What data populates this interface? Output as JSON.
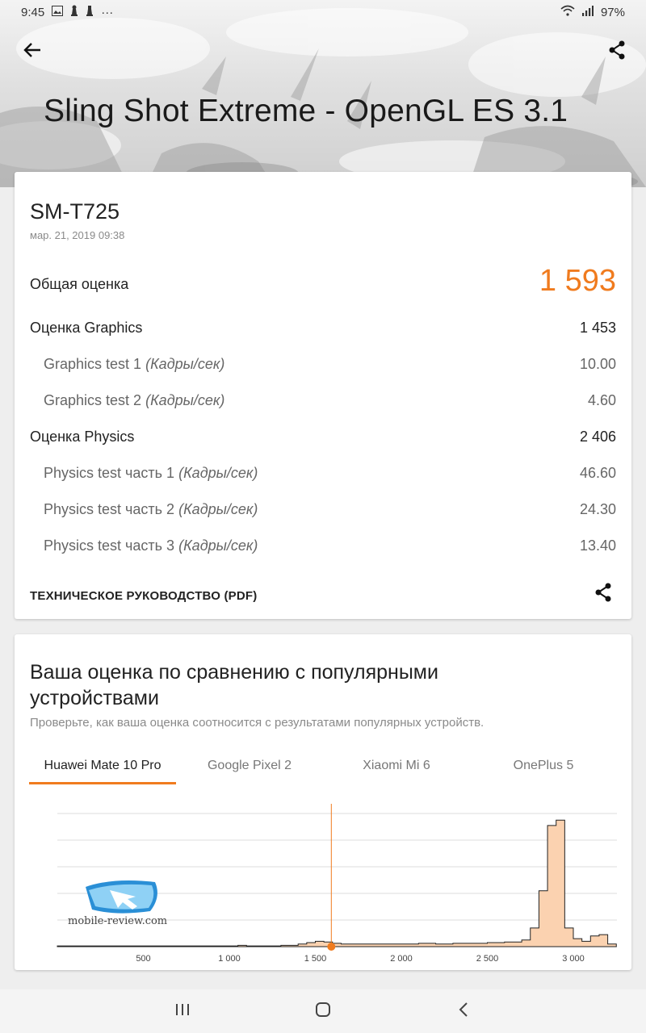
{
  "status_bar": {
    "time": "9:45",
    "more": "···",
    "battery": "97%"
  },
  "header": {
    "title": "Sling Shot Extreme - OpenGL ES 3.1"
  },
  "result": {
    "device": "SM-T725",
    "date": "мар. 21, 2019 09:38",
    "total_label": "Общая оценка",
    "total_value": "1 593",
    "rows": [
      {
        "label": "Оценка Graphics",
        "unit": "",
        "value": "1 453"
      },
      {
        "label": "Graphics test 1",
        "unit": "(Кадры/сек)",
        "value": "10.00"
      },
      {
        "label": "Graphics test 2",
        "unit": "(Кадры/сек)",
        "value": "4.60"
      },
      {
        "label": "Оценка Physics",
        "unit": "",
        "value": "2 406"
      },
      {
        "label": "Physics test часть 1",
        "unit": "(Кадры/сек)",
        "value": "46.60"
      },
      {
        "label": "Physics test часть 2",
        "unit": "(Кадры/сек)",
        "value": "24.30"
      },
      {
        "label": "Physics test часть 3",
        "unit": "(Кадры/сек)",
        "value": "13.40"
      }
    ],
    "guide_link": "ТЕХНИЧЕСКОЕ РУКОВОДСТВО (PDF)"
  },
  "comparison": {
    "title": "Ваша оценка по сравнению с популярными устройствами",
    "subtitle": "Проверьте, как ваша оценка соотносится с результатами популярных устройств.",
    "tabs": [
      "Huawei Mate 10 Pro",
      "Google Pixel 2",
      "Xiaomi Mi 6",
      "OnePlus 5"
    ],
    "active_tab": 0
  },
  "watermark": {
    "text": "mobile-review.com"
  },
  "colors": {
    "accent": "#f07b1e",
    "histogram_fill": "#fbd2b0"
  },
  "icons": {
    "back": "arrow-left-icon",
    "share": "share-icon",
    "nav_recents": "recents-icon",
    "nav_home": "home-icon",
    "nav_back": "chevron-left-icon"
  },
  "chart_data": {
    "type": "area",
    "x_ticks": [
      "500",
      "1 000",
      "1 500",
      "2 000",
      "2 500",
      "3 000"
    ],
    "xlim": [
      0,
      3300
    ],
    "ylim": [
      0,
      100
    ],
    "grid": true,
    "marker_value": 1593,
    "bins": [
      [
        0,
        0.5
      ],
      [
        100,
        0.5
      ],
      [
        200,
        0.5
      ],
      [
        300,
        0.5
      ],
      [
        400,
        0.5
      ],
      [
        500,
        0.5
      ],
      [
        600,
        0.5
      ],
      [
        700,
        0.5
      ],
      [
        800,
        0.5
      ],
      [
        900,
        0.5
      ],
      [
        1000,
        0.5
      ],
      [
        1050,
        1
      ],
      [
        1100,
        0.5
      ],
      [
        1200,
        0.5
      ],
      [
        1300,
        1
      ],
      [
        1400,
        2
      ],
      [
        1450,
        3
      ],
      [
        1500,
        4
      ],
      [
        1550,
        3.5
      ],
      [
        1600,
        2.5
      ],
      [
        1650,
        2
      ],
      [
        1700,
        2
      ],
      [
        1800,
        2
      ],
      [
        1900,
        2
      ],
      [
        2000,
        2
      ],
      [
        2100,
        2.5
      ],
      [
        2200,
        2
      ],
      [
        2300,
        2.5
      ],
      [
        2400,
        2.5
      ],
      [
        2500,
        3
      ],
      [
        2600,
        3.5
      ],
      [
        2700,
        5
      ],
      [
        2750,
        14
      ],
      [
        2800,
        42
      ],
      [
        2850,
        91
      ],
      [
        2900,
        95
      ],
      [
        2950,
        14
      ],
      [
        3000,
        6
      ],
      [
        3050,
        4
      ],
      [
        3100,
        8
      ],
      [
        3150,
        9
      ],
      [
        3200,
        2
      ]
    ]
  }
}
